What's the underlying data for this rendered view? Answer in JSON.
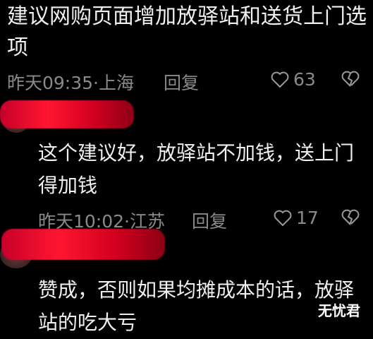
{
  "post": {
    "text": "建议网购页面增加放驿站和送货上门选项",
    "time_location": "昨天09:35·上海",
    "reply_label": "回复",
    "like_count": "63"
  },
  "replies": [
    {
      "text": "这个建议好，放驿站不加钱，送上门得加钱",
      "time_location": "昨天10:02·江苏",
      "reply_label": "回复",
      "like_count": "17"
    },
    {
      "text": "赞成，否则如果均摊成本的话，放驿站的吃大亏"
    }
  ],
  "watermark": "无忧君",
  "icons": {
    "like": "heart-icon",
    "dislike": "broken-heart-icon"
  }
}
